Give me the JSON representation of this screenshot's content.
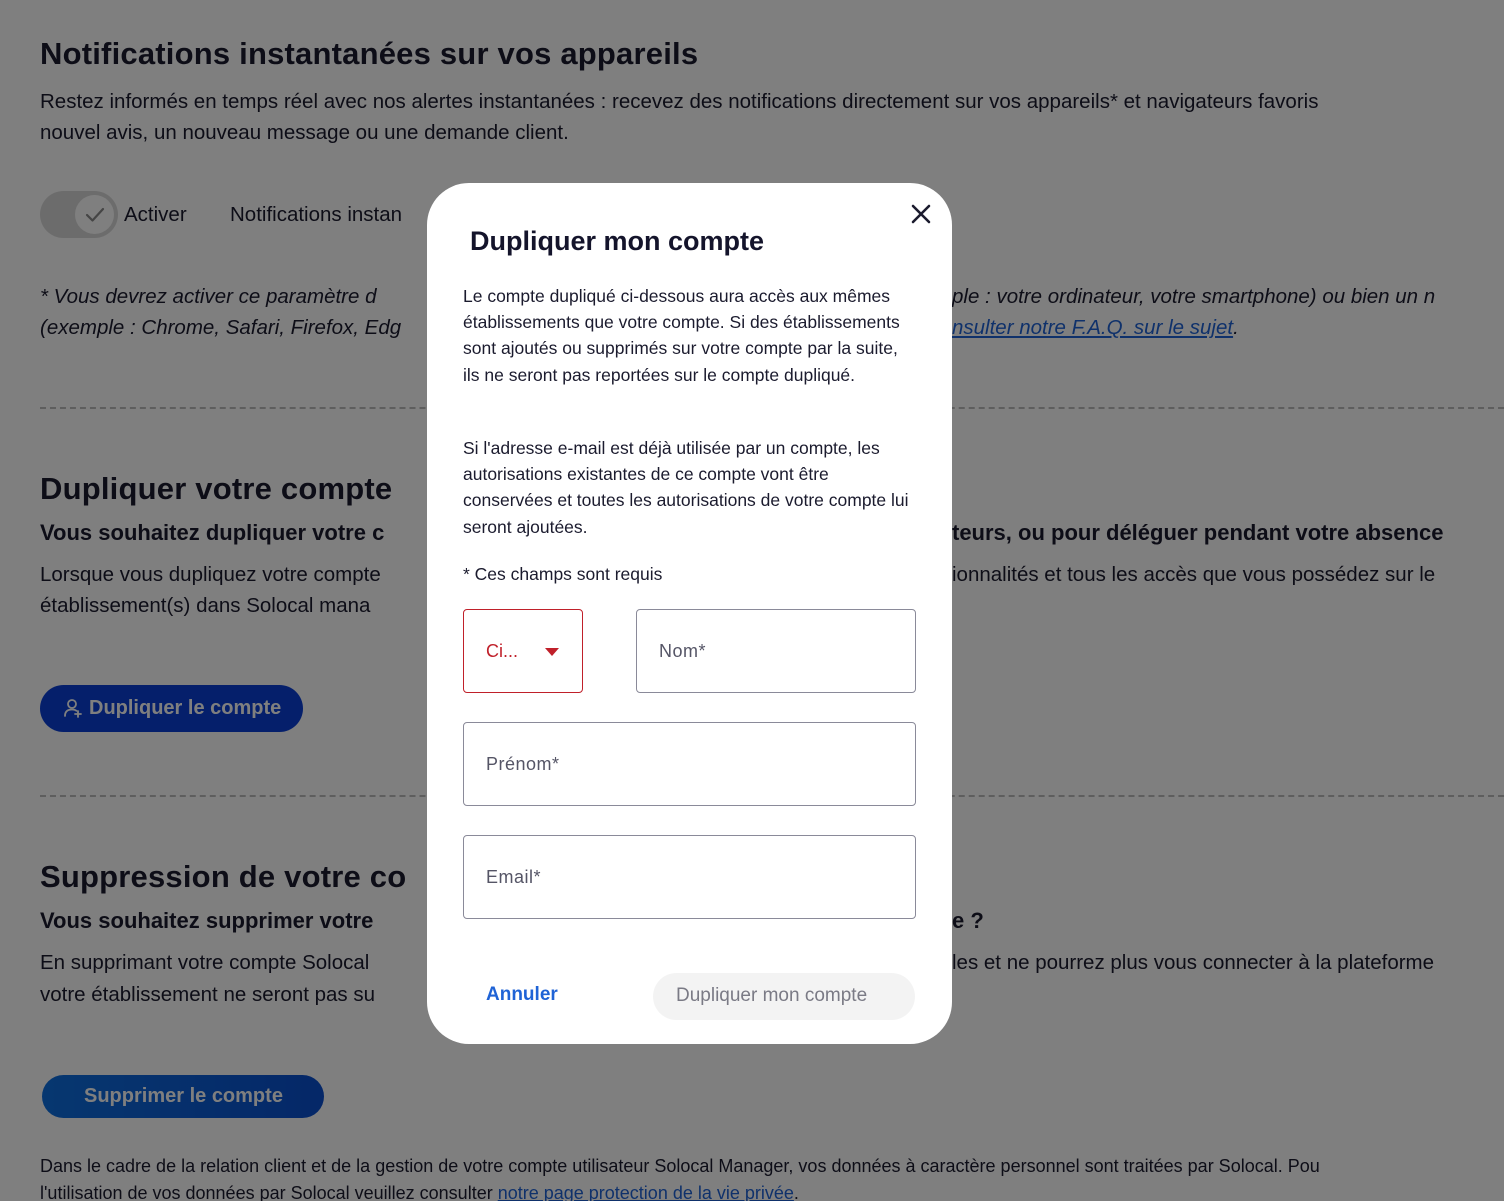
{
  "notifications": {
    "title": "Notifications instantanées sur vos appareils",
    "desc_line1": "Restez informés en temps réel avec nos alertes instantanées : recevez des notifications directement sur vos appareils* et navigateurs favoris",
    "desc_line2": "nouvel avis, un nouveau message ou une demande client.",
    "toggle_label": "Activer",
    "toggle_on": true,
    "setting_label": "Notifications instan",
    "footnote_line1_left": "* Vous devrez activer ce paramètre d",
    "footnote_line1_right": "ple : votre ordinateur, votre smartphone) ou bien un n",
    "footnote_line2_left": "(exemple : Chrome, Safari, Firefox, Edg",
    "footnote_link": "nsulter notre F.A.Q. sur le sujet",
    "footnote_end": "."
  },
  "duplicate": {
    "title": "Dupliquer votre compte",
    "subtitle_left": "Vous souhaitez dupliquer votre c",
    "subtitle_right": "teurs, ou pour déléguer pendant votre absence",
    "text_line1_left": "Lorsque vous dupliquez votre compte",
    "text_line1_right": "ionnalités et tous les accès que vous possédez sur le",
    "text_line2_left": "établissement(s) dans Solocal mana",
    "button": "Dupliquer le compte"
  },
  "delete": {
    "title": "Suppression de votre co",
    "subtitle_left": "Vous souhaitez supprimer votre",
    "subtitle_right": "e ?",
    "text_line1_left": "En supprimant votre compte Solocal",
    "text_line1_right": "les et ne pourrez plus vous connecter à la plateforme",
    "text_line2_left": "votre établissement ne seront pas su",
    "button": "Supprimer le compte"
  },
  "footer": {
    "line1": "Dans le cadre de la relation client et de la gestion de votre compte utilisateur Solocal Manager, vos données à caractère personnel sont traitées par Solocal. Pou",
    "line2_prefix": "l'utilisation de vos données par Solocal veuillez consulter ",
    "line2_link": "notre page protection de la vie privée",
    "line2_end": "."
  },
  "modal": {
    "title": "Dupliquer mon compte",
    "para1": "Le compte dupliqué ci-dessous aura accès aux mêmes établissements que votre compte. Si des établissements sont ajoutés ou supprimés sur votre compte par la suite, ils ne seront pas reportées sur le compte dupliqué.",
    "para2": "Si l'adresse e-mail est déjà utilisée par un compte, les autorisations existantes de ce compte vont être conservées et toutes les autorisations de votre compte lui seront ajoutées.",
    "required_note": "* Ces champs sont requis",
    "civility_value": "Ci...",
    "nom_placeholder": "Nom*",
    "prenom_placeholder": "Prénom*",
    "email_placeholder": "Email*",
    "cancel": "Annuler",
    "submit": "Dupliquer mon compte"
  }
}
